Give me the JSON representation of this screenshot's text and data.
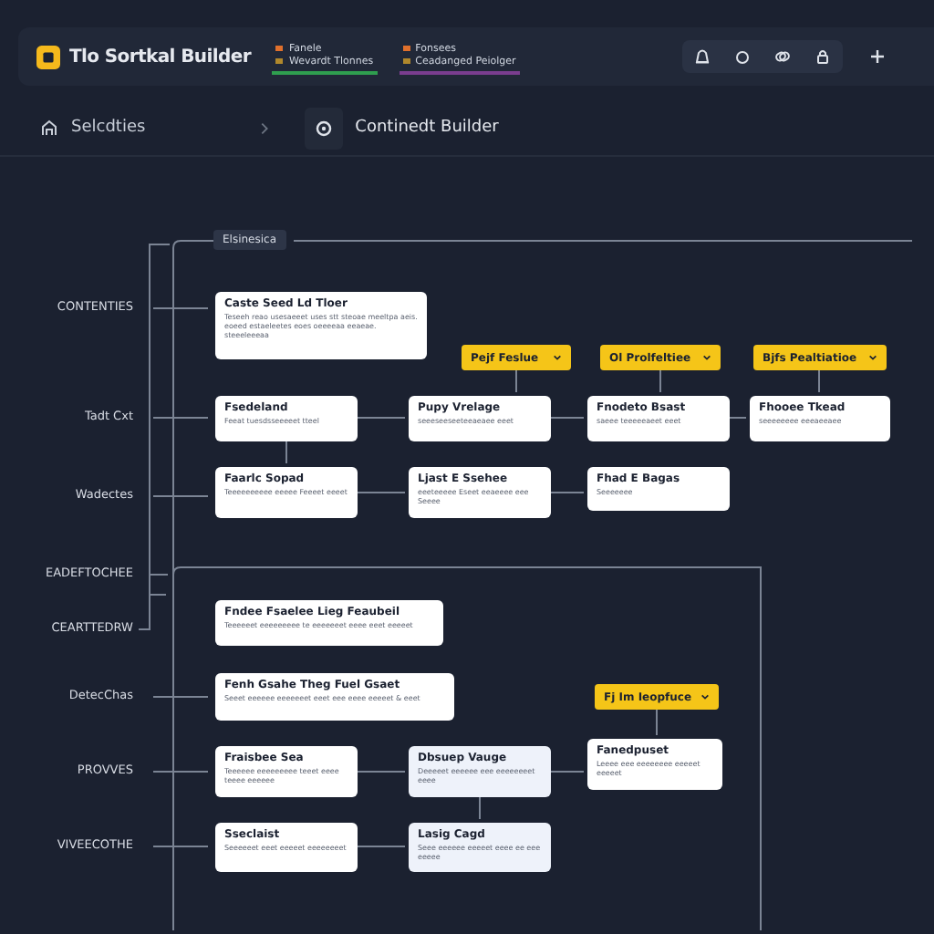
{
  "app": {
    "title": "Tlo Sortkal Builder"
  },
  "header_tabs": [
    {
      "line_1": "Fanele",
      "line_2": "Wevardt Tlonnes",
      "color": "#2f9e4f"
    },
    {
      "line_1": "Fonsees",
      "line_2": "Ceadanged Peiolger",
      "color": "#7a3d8f"
    }
  ],
  "breadcrumb": [
    {
      "label": "Selcdties"
    },
    {
      "label": "Continedt Builder"
    }
  ],
  "sections": [
    {
      "tag": "Elsinesica",
      "labels": [
        "CONTENTIES",
        "Tadt Cxt",
        "Wadectes"
      ],
      "dropdowns": [
        {
          "label": "Pejf Feslue"
        },
        {
          "label": "Ol Prolfeltiee"
        },
        {
          "label": "Bjfs Pealtiatioe"
        }
      ],
      "nodes": [
        {
          "title": "Caste Seed Ld Tloer",
          "desc": "Teseeh reao usesaeeet uses stt steoae meeltpa aeis. eoeed estaeleetes eoes oeeeeaa eeaeae. steeeleeeaa",
          "kind": "plain"
        },
        {
          "title": "Fsedeland",
          "desc": "Feeat tuesdsseeeeet tteel",
          "kind": "plain"
        },
        {
          "title": "Pupy Vrelage",
          "desc": "seeeseeseeteeaeaee eeet",
          "kind": "plain"
        },
        {
          "title": "Fnodeto Bsast",
          "desc": "saeee teeeeeaeet eeet",
          "kind": "plain"
        },
        {
          "title": "Fhooee Tkead",
          "desc": "seeeeeeee eeeaeeaee",
          "kind": "plain"
        },
        {
          "title": "Faarlc Sopad",
          "desc": "Teeeeeeeeee eeeee Feeeet eeeet",
          "kind": "plain"
        },
        {
          "title": "Ljast E Ssehee",
          "desc": "eeeteeeee Eseet eeaeeee eee Seeee",
          "kind": "plain"
        },
        {
          "title": "Fhad E Bagas",
          "desc": "Seeeeeee",
          "kind": "plain"
        }
      ]
    },
    {
      "tag": "EADEFTOCHEE",
      "labels": [
        "CEARTTEDRW",
        "DetecChas",
        "PROVVES",
        "VIVEECOTHE"
      ],
      "dropdowns": [
        {
          "label": "Fj Im Ieopfuce"
        }
      ],
      "nodes": [
        {
          "title": "Fndee Fsaelee Lieg Feaubeil",
          "desc": "Teeeeeet eeeeeeeee te eeeeeeet eeee eeet eeeeet",
          "kind": "plain"
        },
        {
          "title": "Fenh Gsahe Theg Fuel Gsaet",
          "desc": "Seeet eeeeee eeeeeeet eeet eee eeee eeeeet & eeet",
          "kind": "plain"
        },
        {
          "title": "Fraisbee Sea",
          "desc": "Teeeeee eeeeeeeee teeet eeee teeee eeeeee",
          "kind": "plain"
        },
        {
          "title": "Dbsuep Vauge",
          "desc": "Deeeeet eeeeee eee eeeeeeeet eeee",
          "kind": "tinted"
        },
        {
          "title": "Fanedpuset",
          "desc": "Leeee eee eeeeeeee eeeeet eeeeet",
          "kind": "plain"
        },
        {
          "title": "Sseclaist",
          "desc": "Seeeeeet eeet eeeeet eeeeeeeet",
          "kind": "plain"
        },
        {
          "title": "Lasig Cagd",
          "desc": "Seee eeeeee eeeeet eeee ee eee eeeee",
          "kind": "tinted"
        }
      ]
    }
  ]
}
